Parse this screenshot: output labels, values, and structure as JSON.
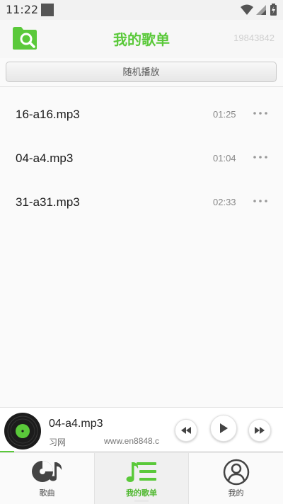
{
  "status_bar": {
    "time": "11:22"
  },
  "header": {
    "title": "我的歌单",
    "id_text": "19843842"
  },
  "shuffle": {
    "label": "随机播放"
  },
  "songs": [
    {
      "name": "16-a16.mp3",
      "duration": "01:25"
    },
    {
      "name": "04-a4.mp3",
      "duration": "01:04"
    },
    {
      "name": "31-a31.mp3",
      "duration": "02:33"
    }
  ],
  "player": {
    "title": "04-a4.mp3",
    "subtitle_part1": "习网",
    "subtitle_part2": "www.en8848.c",
    "progress": 0.05
  },
  "tabs": [
    {
      "label": "歌曲",
      "icon": "disc-music-icon",
      "active": false
    },
    {
      "label": "我的歌单",
      "icon": "playlist-icon",
      "active": true
    },
    {
      "label": "我的",
      "icon": "user-icon",
      "active": false
    }
  ],
  "colors": {
    "accent": "#5ac93a",
    "text": "#1a1a1a",
    "muted": "#888888"
  }
}
